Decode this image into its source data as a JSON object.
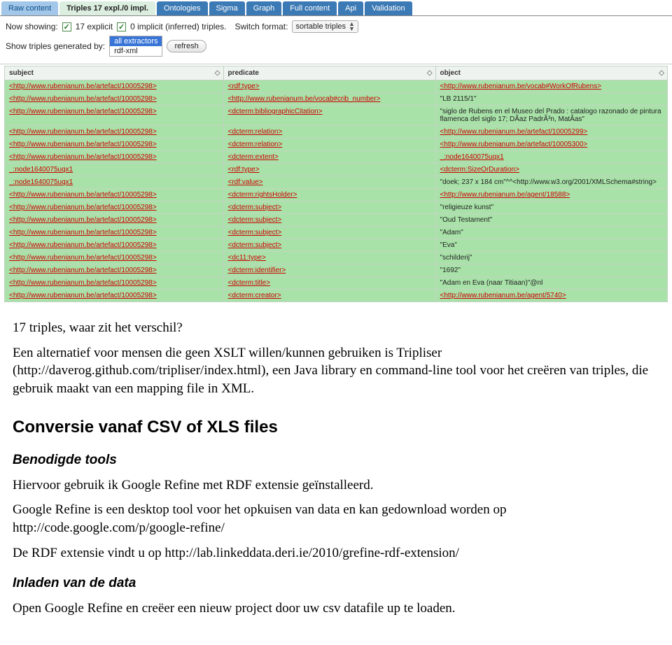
{
  "tabs": [
    {
      "label": "Raw content",
      "key": "raw"
    },
    {
      "label": "Triples 17 expl./0 impl.",
      "key": "triples"
    },
    {
      "label": "Ontologies",
      "key": "ont"
    },
    {
      "label": "Sigma",
      "key": "sigma"
    },
    {
      "label": "Graph",
      "key": "graph"
    },
    {
      "label": "Full content",
      "key": "full"
    },
    {
      "label": "Api",
      "key": "api"
    },
    {
      "label": "Validation",
      "key": "valid"
    }
  ],
  "toolbar": {
    "now_showing": "Now showing:",
    "cb1_label": "17 explicit",
    "cb2_label": "0 implicit (inferred) triples.",
    "switch_format": "Switch format:",
    "format_value": "sortable triples",
    "show_generated_by": "Show triples generated by:",
    "extractors": [
      "all extractors",
      "rdf-xml"
    ],
    "refresh": "refresh"
  },
  "columns": [
    "subject",
    "predicate",
    "object"
  ],
  "rows": [
    {
      "s": "<http://www.rubenianum.be/artefact/10005298>",
      "s_link": true,
      "p": "<rdf:type>",
      "p_link": true,
      "o": "<http://www.rubenianum.be/vocab#WorkOfRubens>",
      "o_link": true
    },
    {
      "s": "<http://www.rubenianum.be/artefact/10005298>",
      "s_link": true,
      "p": "<http://www.rubenianum.be/vocab#crib_number>",
      "p_link": true,
      "o": "\"LB 2115/1\"",
      "o_link": false
    },
    {
      "s": "<http://www.rubenianum.be/artefact/10005298>",
      "s_link": true,
      "p": "<dcterm:bibliographicCitation>",
      "p_link": true,
      "o": "\"siglo de Rubens en el Museo del Prado : catalogo razonado de pintura flamenca del siglo 17; DÃ­az PadrÃ³n, MatÃ­as\"",
      "o_link": false
    },
    {
      "s": "<http://www.rubenianum.be/artefact/10005298>",
      "s_link": true,
      "p": "<dcterm:relation>",
      "p_link": true,
      "o": "<http://www.rubenianum.be/artefact/10005299>",
      "o_link": true
    },
    {
      "s": "<http://www.rubenianum.be/artefact/10005298>",
      "s_link": true,
      "p": "<dcterm:relation>",
      "p_link": true,
      "o": "<http://www.rubenianum.be/artefact/10005300>",
      "o_link": true
    },
    {
      "s": "<http://www.rubenianum.be/artefact/10005298>",
      "s_link": true,
      "p": "<dcterm:extent>",
      "p_link": true,
      "o": "_:node1640075uqx1",
      "o_link": true
    },
    {
      "s": "_:node1640075uqx1",
      "s_link": true,
      "p": "<rdf:type>",
      "p_link": true,
      "o": "<dcterm:SizeOrDuration>",
      "o_link": true
    },
    {
      "s": "_:node1640075uqx1",
      "s_link": true,
      "p": "<rdf:value>",
      "p_link": true,
      "o": "\"doek; 237 x 184 cm\"^^<http://www.w3.org/2001/XMLSchema#string>",
      "o_link": false
    },
    {
      "s": "<http://www.rubenianum.be/artefact/10005298>",
      "s_link": true,
      "p": "<dcterm:rightsHolder>",
      "p_link": true,
      "o": "<http://www.rubenianum.be/agent/18588>",
      "o_link": true
    },
    {
      "s": "<http://www.rubenianum.be/artefact/10005298>",
      "s_link": true,
      "p": "<dcterm:subject>",
      "p_link": true,
      "o": "\"religieuze kunst\"",
      "o_link": false
    },
    {
      "s": "<http://www.rubenianum.be/artefact/10005298>",
      "s_link": true,
      "p": "<dcterm:subject>",
      "p_link": true,
      "o": "\"Oud Testament\"",
      "o_link": false
    },
    {
      "s": "<http://www.rubenianum.be/artefact/10005298>",
      "s_link": true,
      "p": "<dcterm:subject>",
      "p_link": true,
      "o": "\"Adam\"",
      "o_link": false
    },
    {
      "s": "<http://www.rubenianum.be/artefact/10005298>",
      "s_link": true,
      "p": "<dcterm:subject>",
      "p_link": true,
      "o": "\"Eva\"",
      "o_link": false
    },
    {
      "s": "<http://www.rubenianum.be/artefact/10005298>",
      "s_link": true,
      "p": "<dc11:type>",
      "p_link": true,
      "o": "\"schilderij\"",
      "o_link": false
    },
    {
      "s": "<http://www.rubenianum.be/artefact/10005298>",
      "s_link": true,
      "p": "<dcterm:identifier>",
      "p_link": true,
      "o": "\"1692\"",
      "o_link": false
    },
    {
      "s": "<http://www.rubenianum.be/artefact/10005298>",
      "s_link": true,
      "p": "<dcterm:title>",
      "p_link": true,
      "o": "\"Adam en Eva (naar Titiaan)\"@nl",
      "o_link": false
    },
    {
      "s": "<http://www.rubenianum.be/artefact/10005298>",
      "s_link": true,
      "p": "<dcterm:creator>",
      "p_link": true,
      "o": "<http://www.rubenianum.be/agent/5740>",
      "o_link": true
    }
  ],
  "doc": {
    "p1": "17 triples, waar zit het verschil?",
    "p2": "Een alternatief voor mensen die geen XSLT willen/kunnen gebruiken is Tripliser (http://daverog.github.com/tripliser/index.html), een Java library en command-line tool voor het creëren van triples, die gebruik maakt van een mapping file in XML.",
    "h2": "Conversie vanaf CSV of XLS files",
    "h3a": "Benodigde tools",
    "p3": "Hiervoor gebruik ik Google Refine met RDF extensie geïnstalleerd.",
    "p4": "Google Refine is een desktop tool voor het opkuisen van data en kan gedownload worden op http://code.google.com/p/google-refine/",
    "p5": "De RDF extensie vindt u op http://lab.linkeddata.deri.ie/2010/grefine-rdf-extension/",
    "h3b": "Inladen van de data",
    "p6": "Open Google Refine en creëer een nieuw project door uw csv datafile up te loaden."
  }
}
